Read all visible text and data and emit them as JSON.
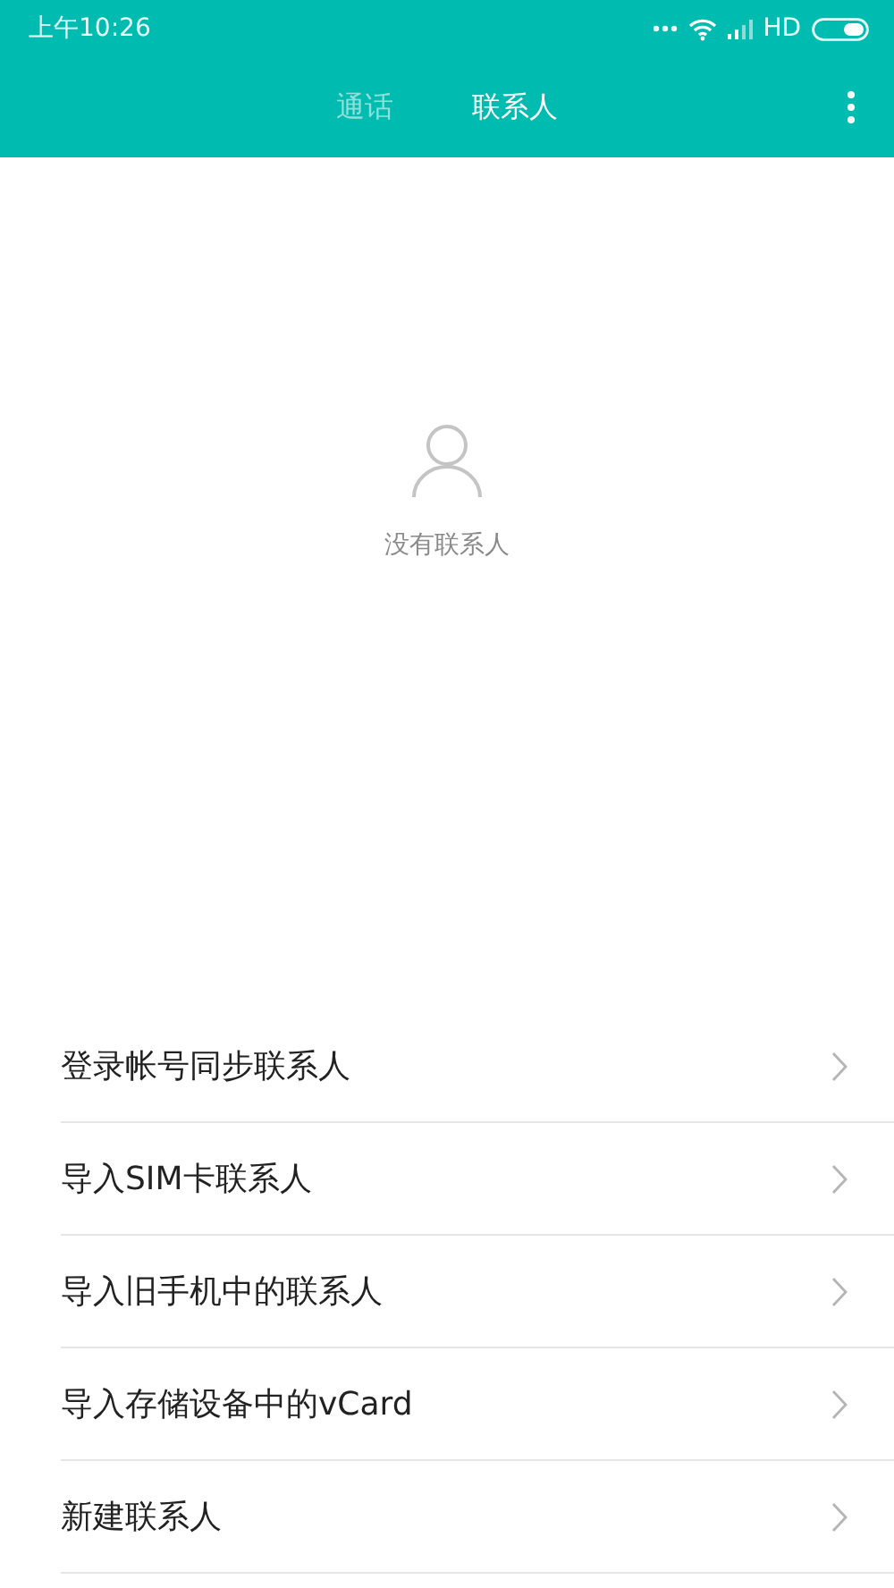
{
  "status_bar": {
    "time": "上午10:26",
    "network": "HD"
  },
  "tabs": [
    {
      "label": "通话",
      "selected": false
    },
    {
      "label": "联系人",
      "selected": true
    }
  ],
  "empty_state": {
    "message": "没有联系人"
  },
  "actions": [
    {
      "label": "登录帐号同步联系人"
    },
    {
      "label": "导入SIM卡联系人"
    },
    {
      "label": "导入旧手机中的联系人"
    },
    {
      "label": "导入存储设备中的vCard"
    },
    {
      "label": "新建联系人"
    }
  ]
}
